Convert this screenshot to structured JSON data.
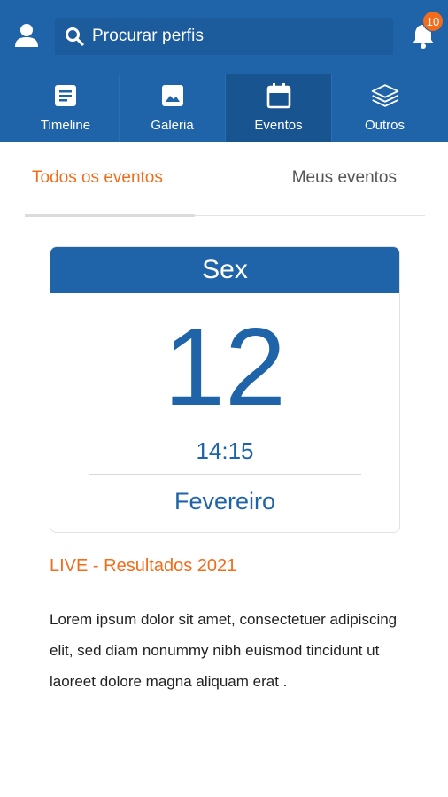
{
  "header": {
    "search_placeholder": "Procurar perfis",
    "notifications_count": "10",
    "colors": {
      "primary": "#1f63a8",
      "accent": "#f26c1b"
    },
    "icons": {
      "user": "user-icon",
      "search": "search-icon",
      "bell": "bell-icon"
    }
  },
  "tabs": [
    {
      "label": "Timeline",
      "icon": "document-icon",
      "active": false
    },
    {
      "label": "Galeria",
      "icon": "image-icon",
      "active": false
    },
    {
      "label": "Eventos",
      "icon": "calendar-icon",
      "active": true
    },
    {
      "label": "Outros",
      "icon": "layers-icon",
      "active": false
    }
  ],
  "subtabs": {
    "all": "Todos os eventos",
    "mine": "Meus eventos",
    "selected": "all"
  },
  "event_card": {
    "weekday": "Sex",
    "day": "12",
    "time": "14:15",
    "month": "Fevereiro"
  },
  "event": {
    "title": "LIVE - Resultados 2021",
    "description": "Lorem ipsum dolor sit amet, consectetuer adipiscing elit, sed diam nonummy nibh euismod tincidunt ut laoreet dolore magna aliquam erat ."
  }
}
